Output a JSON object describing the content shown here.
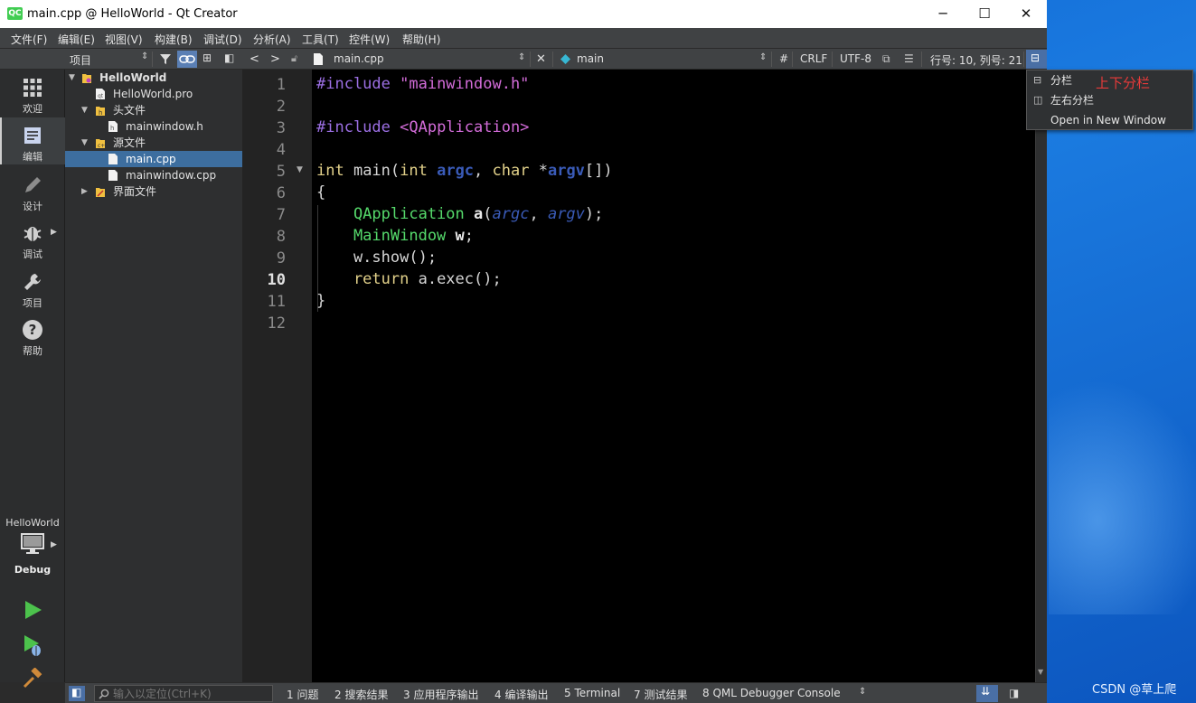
{
  "window": {
    "title": "main.cpp @ HelloWorld - Qt Creator",
    "logo_text": "QC",
    "controls": {
      "minimize": "─",
      "maximize": "☐",
      "close": "✕"
    }
  },
  "menu": [
    "文件(F)",
    "编辑(E)",
    "视图(V)",
    "构建(B)",
    "调试(D)",
    "分析(A)",
    "工具(T)",
    "控件(W)",
    "帮助(H)"
  ],
  "modes": [
    {
      "label": "欢迎",
      "icon": "grid-icon"
    },
    {
      "label": "编辑",
      "icon": "edit-document-icon",
      "active": true
    },
    {
      "label": "设计",
      "icon": "pencil-icon"
    },
    {
      "label": "调试",
      "icon": "bug-icon"
    },
    {
      "label": "项目",
      "icon": "wrench-icon"
    },
    {
      "label": "帮助",
      "icon": "help-icon"
    }
  ],
  "kit": {
    "project": "HelloWorld",
    "build": "Debug"
  },
  "project_pane": {
    "title": "项目",
    "tree": [
      {
        "label": "HelloWorld",
        "level": 0,
        "expanded": true,
        "bold": true,
        "type": "project"
      },
      {
        "label": "HelloWorld.pro",
        "level": 1,
        "type": "pro"
      },
      {
        "label": "头文件",
        "level": 1,
        "expanded": true,
        "type": "folder-h"
      },
      {
        "label": "mainwindow.h",
        "level": 2,
        "type": "file"
      },
      {
        "label": "源文件",
        "level": 1,
        "expanded": true,
        "type": "folder-cpp"
      },
      {
        "label": "main.cpp",
        "level": 2,
        "type": "file",
        "selected": true
      },
      {
        "label": "mainwindow.cpp",
        "level": 2,
        "type": "file"
      },
      {
        "label": "界面文件",
        "level": 1,
        "expanded": false,
        "type": "folder-ui"
      }
    ]
  },
  "editor_toolbar": {
    "file": "main.cpp",
    "symbol": "main",
    "hash": "#",
    "line_ending": "CRLF",
    "encoding": "UTF-8",
    "position": "行号: 10, 列号: 21"
  },
  "editor": {
    "line_numbers": [
      "1",
      "2",
      "3",
      "4",
      "5",
      "6",
      "7",
      "8",
      "9",
      "10",
      "11",
      "12"
    ],
    "current_line": 10,
    "code": {
      "l1_pp": "#include",
      "l1_str": " \"mainwindow.h\"",
      "l3_pp": "#include",
      "l3_str": " <QApplication>",
      "l5_kw1": "int",
      "l5_t1": " main(",
      "l5_kw2": "int",
      "l5_arg1": " argc",
      "l5_t2": ", ",
      "l5_kw3": "char",
      "l5_t3": " *",
      "l5_arg2": "argv",
      "l5_t4": "[])",
      "l6": "{",
      "l7_cls": "    QApplication",
      "l7_t1": " ",
      "l7_b": "a",
      "l7_t2": "(",
      "l7_a1": "argc",
      "l7_t3": ", ",
      "l7_a2": "argv",
      "l7_t4": ");",
      "l8_cls": "    MainWindow",
      "l8_t1": " ",
      "l8_b": "w",
      "l8_t2": ";",
      "l9": "    w.show();",
      "l10_kw": "    return",
      "l10_t": " a.exec();",
      "l11": "}"
    }
  },
  "split_menu": {
    "options": [
      "分栏",
      "左右分栏",
      "Open in New Window"
    ],
    "annotation": "上下分栏"
  },
  "statusbar": {
    "locator_placeholder": "输入以定位(Ctrl+K)",
    "panes": [
      "1 问题",
      "2 搜索结果",
      "3 应用程序输出",
      "4 编译输出",
      "5 Terminal",
      "7 测试结果",
      "8 QML Debugger Console"
    ]
  },
  "watermark": "CSDN @草上爬"
}
